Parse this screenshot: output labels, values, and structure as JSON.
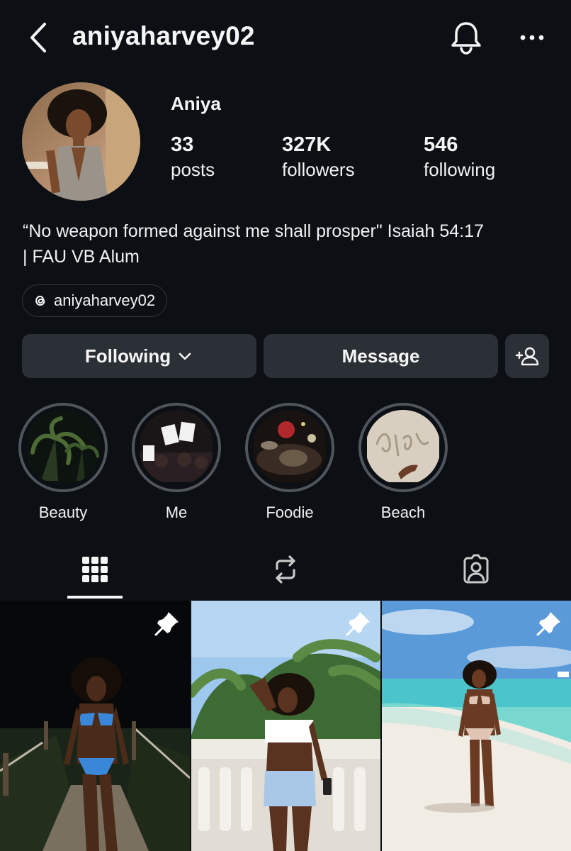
{
  "header": {
    "username": "aniyaharvey02",
    "icons": [
      "back-chevron-icon",
      "bell-icon",
      "more-dots-icon"
    ]
  },
  "profile": {
    "display_name": "Aniya",
    "stats": [
      {
        "value": "33",
        "label": "posts"
      },
      {
        "value": "327K",
        "label": "followers"
      },
      {
        "value": "546",
        "label": "following"
      }
    ],
    "bio_line1": "“No weapon formed against me shall prosper\" Isaiah 54:17",
    "bio_line2": "| FAU VB Alum",
    "threads_handle": "aniyaharvey02"
  },
  "actions": {
    "following_label": "Following",
    "message_label": "Message"
  },
  "highlights": [
    {
      "label": "Beauty"
    },
    {
      "label": "Me"
    },
    {
      "label": "Foodie"
    },
    {
      "label": "Beach"
    }
  ],
  "tabs": [
    "grid-icon",
    "reposts-icon",
    "tagged-icon"
  ],
  "posts": [
    {
      "pinned": true
    },
    {
      "pinned": true
    },
    {
      "pinned": true
    }
  ],
  "colors": {
    "background": "#0c0f14",
    "button": "#2b2f36",
    "text": "#f5f5f5"
  }
}
